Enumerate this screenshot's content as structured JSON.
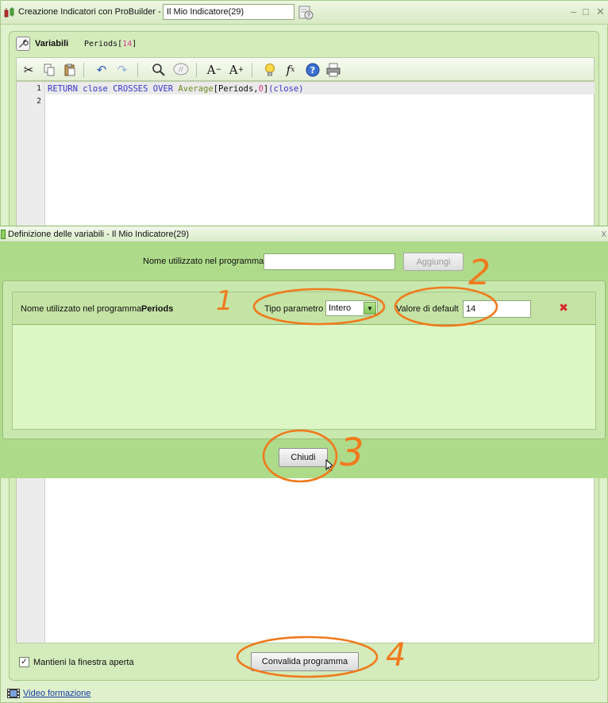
{
  "window": {
    "title": "Creazione Indicatori con ProBuilder",
    "title_sep": "-",
    "indicator_name": "Il Mio Indicatore(29)",
    "controls": {
      "minimize": "–",
      "maximize": "□",
      "close": "✕"
    }
  },
  "editor": {
    "header_label": "Variabili",
    "header_var_name": "Periods",
    "header_var_open": "[",
    "header_var_value": "14",
    "header_var_close": "]",
    "toolbar": [
      {
        "name": "cut-icon",
        "glyph": "✂"
      },
      {
        "name": "copy-icon",
        "glyph": "⧉"
      },
      {
        "name": "paste-icon",
        "glyph": "📋"
      },
      {
        "name": "undo-icon",
        "glyph": "↶"
      },
      {
        "name": "redo-icon",
        "glyph": "↷"
      },
      {
        "name": "search-icon",
        "glyph": "🔍"
      },
      {
        "name": "comment-icon",
        "glyph": "//"
      },
      {
        "name": "font-decrease-icon",
        "glyph": "A−"
      },
      {
        "name": "font-increase-icon",
        "glyph": "A+"
      },
      {
        "name": "lightbulb-icon",
        "glyph": "💡"
      },
      {
        "name": "function-icon",
        "glyph": "fx"
      },
      {
        "name": "help-icon",
        "glyph": "?"
      },
      {
        "name": "print-icon",
        "glyph": "🖶"
      }
    ],
    "line_numbers": [
      "1",
      "2"
    ],
    "code": {
      "return": "RETURN",
      "close": "close",
      "crosses": "CROSSES",
      "over": "OVER",
      "average": "Average",
      "bracket_open": "[",
      "param": "Periods,",
      "zero": "0",
      "bracket_close": "]",
      "paren_expr": "(close)"
    },
    "keep_open_label": "Mantieni la finestra aperta",
    "keep_open_checked": "✓",
    "validate_button": "Convalida programma",
    "video_link": "Video formazione"
  },
  "dialog": {
    "title": "Definizione delle variabili - Il Mio Indicatore(29)",
    "close_glyph": "x",
    "name_label": "Nome utilizzato nel programma",
    "name_value": "",
    "add_button": "Aggiungi",
    "variable": {
      "name_label": "Nome utilizzato nel programma",
      "name": "Periods",
      "type_label": "Tipo parametro",
      "type_value": "Intero",
      "default_label": "Valore di default",
      "default_value": "14"
    },
    "close_button": "Chiudi"
  },
  "annotations": {
    "a1": "1",
    "a2": "2",
    "a3": "3",
    "a4": "4"
  },
  "colors": {
    "annotation": "#f07a1c",
    "keyword": "#3737c8",
    "function": "#6d8a1e",
    "number": "#d43d8f"
  }
}
